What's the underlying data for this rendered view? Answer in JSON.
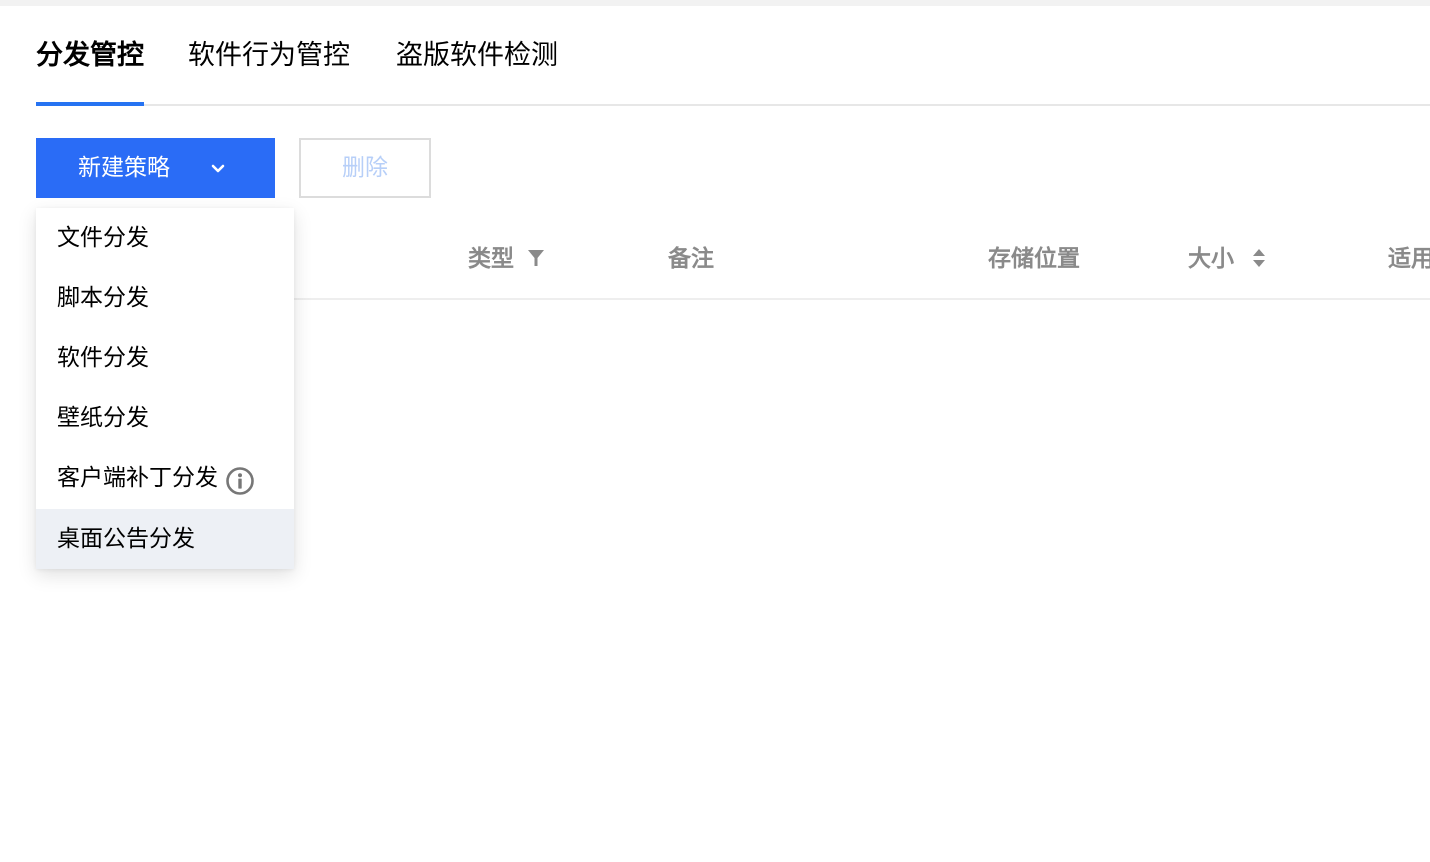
{
  "tabs": [
    {
      "label": "分发管控",
      "active": true
    },
    {
      "label": "软件行为管控",
      "active": false
    },
    {
      "label": "盗版软件检测",
      "active": false
    }
  ],
  "toolbar": {
    "new_policy_label": "新建策略",
    "delete_label": "删除"
  },
  "table": {
    "columns": [
      "类型",
      "备注",
      "存储位置",
      "大小",
      "适用"
    ]
  },
  "dropdown": {
    "items": [
      {
        "label": "文件分发"
      },
      {
        "label": "脚本分发"
      },
      {
        "label": "软件分发"
      },
      {
        "label": "壁纸分发"
      },
      {
        "label": "客户端补丁分发",
        "icon": "info-icon"
      },
      {
        "label": "桌面公告分发",
        "hovered": true
      }
    ]
  },
  "colors": {
    "primary": "#2a6cf6",
    "tab_indicator": "#2673f2",
    "disabled_text": "#b7cff8",
    "header_text": "#8a8a8a",
    "hover_bg": "#edf0f5"
  }
}
